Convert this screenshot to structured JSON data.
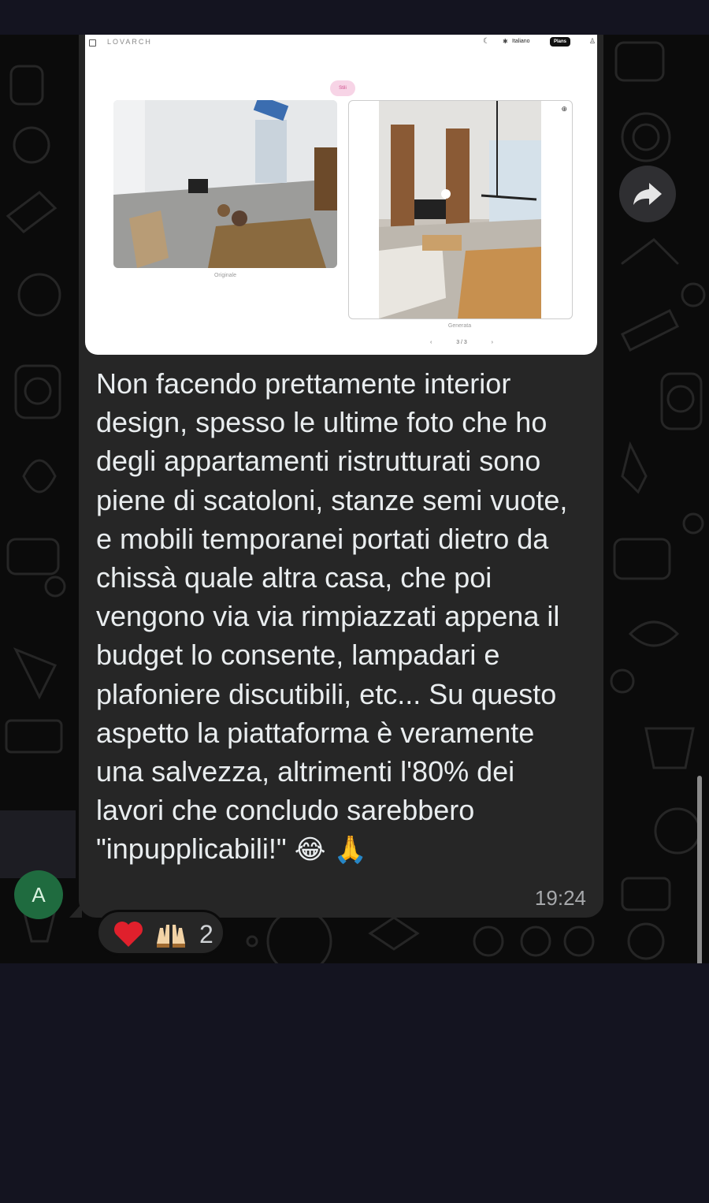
{
  "screenshot": {
    "brand": "LOVARCH",
    "language": "Italiano",
    "plans_label": "Plans",
    "style_badge": "Stili",
    "caption_original": "Originale",
    "caption_generated": "Generata",
    "pager": "3 / 3"
  },
  "message": {
    "text": "Non facendo prettamente interior design, spesso le ultime foto che ho degli appartamenti ristrutturati sono piene di scatoloni, stanze semi vuote, e mobili temporanei portati dietro da chissà quale altra casa, che poi vengono via via rimpiazzati appena il budget lo consente, lampadari e plafoniere discutibili, etc... Su questo aspetto la piattaforma è veramente una salvezza, altrimenti l'80% dei lavori che concludo sarebbero \"inpupplicabili!\"",
    "emoji_1": "😂",
    "emoji_2": "🙏",
    "time": "19:24"
  },
  "sender": {
    "avatar_letter": "A"
  },
  "reactions": {
    "count": "2",
    "icons": [
      "red-heart-icon",
      "raising-hands-icon"
    ]
  },
  "colors": {
    "bubble": "#262626",
    "avatar": "#1f6b3f",
    "background": "#0b0b0b"
  }
}
